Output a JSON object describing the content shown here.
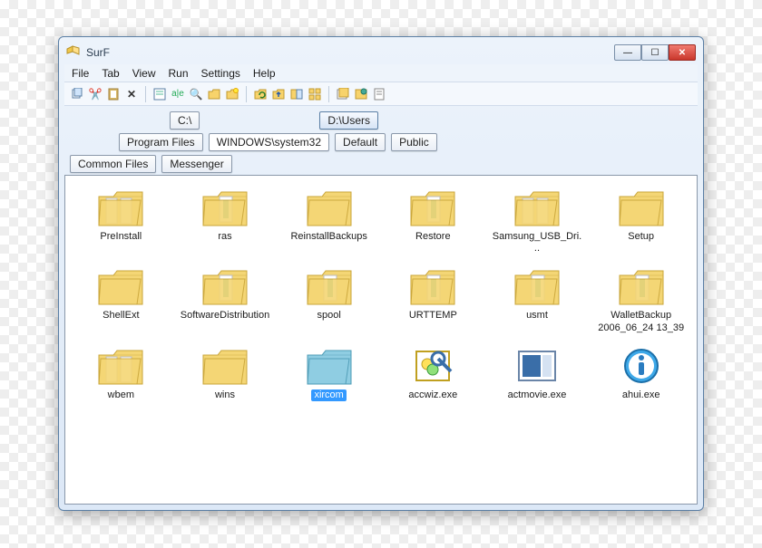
{
  "window": {
    "title": "SurF"
  },
  "menubar": [
    "File",
    "Tab",
    "View",
    "Run",
    "Settings",
    "Help"
  ],
  "toolbar_icons": [
    "copy",
    "cut",
    "paste",
    "delete",
    "properties",
    "rename",
    "search",
    "new-folder",
    "new-file",
    "refresh",
    "up",
    "view-thumbs",
    "view-list",
    "history",
    "favorites",
    "options"
  ],
  "tabtree": {
    "row1": [
      {
        "label": "C:\\",
        "active": false
      },
      {
        "label": "D:\\Users",
        "active": true
      }
    ],
    "row2": [
      {
        "label": "Program Files",
        "active": false
      },
      {
        "label": "WINDOWS\\system32",
        "active": false
      },
      {
        "label": "Default",
        "active": false
      },
      {
        "label": "Public",
        "active": false
      }
    ],
    "row3": [
      {
        "label": "Common Files",
        "active": false
      },
      {
        "label": "Messenger",
        "active": false
      }
    ]
  },
  "items": [
    {
      "name": "PreInstall",
      "type": "folder",
      "variant": "open"
    },
    {
      "name": "ras",
      "type": "folder",
      "variant": "doc"
    },
    {
      "name": "ReinstallBackups",
      "type": "folder",
      "variant": "plain"
    },
    {
      "name": "Restore",
      "type": "folder",
      "variant": "doc"
    },
    {
      "name": "Samsung_USB_Dri...",
      "type": "folder",
      "variant": "open"
    },
    {
      "name": "Setup",
      "type": "folder",
      "variant": "plain"
    },
    {
      "name": "ShellExt",
      "type": "folder",
      "variant": "plain"
    },
    {
      "name": "SoftwareDistribution",
      "type": "folder",
      "variant": "doc"
    },
    {
      "name": "spool",
      "type": "folder",
      "variant": "doc"
    },
    {
      "name": "URTTEMP",
      "type": "folder",
      "variant": "doc"
    },
    {
      "name": "usmt",
      "type": "folder",
      "variant": "doc"
    },
    {
      "name": "WalletBackup 2006_06_24 13_39",
      "type": "folder",
      "variant": "doc"
    },
    {
      "name": "wbem",
      "type": "folder",
      "variant": "open"
    },
    {
      "name": "wins",
      "type": "folder",
      "variant": "plain"
    },
    {
      "name": "xircom",
      "type": "folder",
      "variant": "blue",
      "selected": true
    },
    {
      "name": "accwiz.exe",
      "type": "exe",
      "variant": "accwiz"
    },
    {
      "name": "actmovie.exe",
      "type": "exe",
      "variant": "actmovie"
    },
    {
      "name": "ahui.exe",
      "type": "exe",
      "variant": "info"
    }
  ]
}
